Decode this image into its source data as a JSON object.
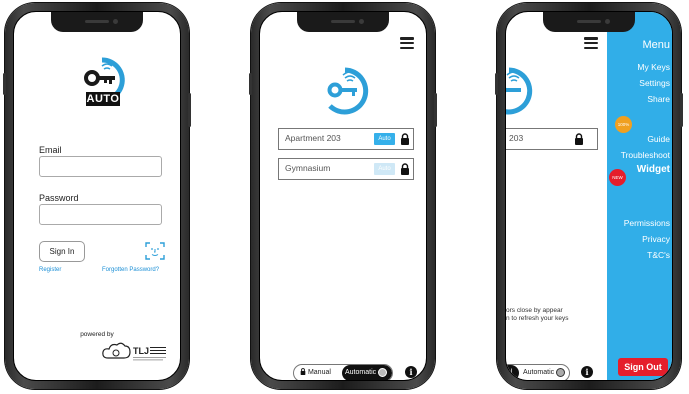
{
  "login": {
    "brand_badge": "AUTO",
    "email_label": "Email",
    "password_label": "Password",
    "sign_in_label": "Sign In",
    "register_label": "Register",
    "forgot_label": "Forgotten Password?",
    "powered_by": "powered by",
    "tlj_logo_text": "TLJ"
  },
  "keys_screen": {
    "keys": [
      {
        "name": "Apartment 203",
        "tag": "Auto",
        "tag_color": "#35b0ea"
      },
      {
        "name": "Gymnasium",
        "tag": "Auto",
        "tag_color": "#cfe8f6"
      }
    ],
    "mode_manual": "Manual",
    "mode_automatic": "Automatic",
    "info_icon": "i"
  },
  "menu_screen": {
    "partial_key_name": "203",
    "note_line1": "ors close by appear",
    "note_line2": "n to refresh your keys",
    "mode_manual_partial": "al",
    "mode_automatic": "Automatic",
    "menu_title": "Menu",
    "items": [
      "My Keys",
      "Settings",
      "Share",
      "Guide",
      "Troubleshoot",
      "Widget",
      "Permissions",
      "Privacy",
      "T&C's"
    ],
    "badge_100": "100%",
    "badge_new": "NEW",
    "sign_out": "Sign Out",
    "accent_color": "#31aee8",
    "signout_color": "#e51e2b"
  }
}
